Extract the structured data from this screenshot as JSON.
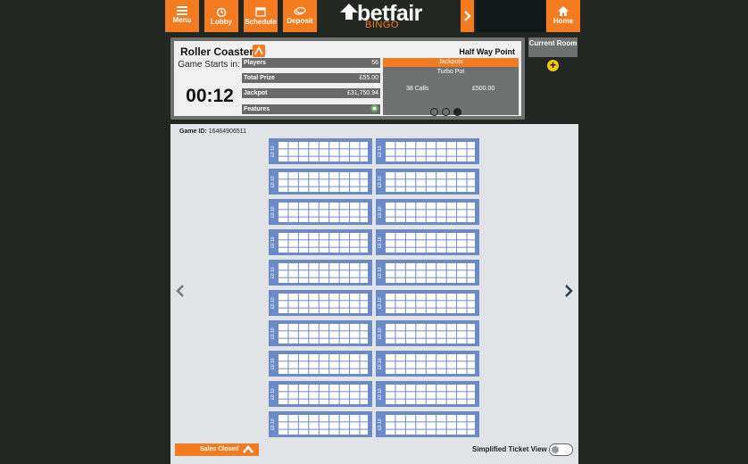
{
  "nav": {
    "menu": "Menu",
    "lobby": "Lobby",
    "schedule": "Schedule",
    "deposit": "Deposit",
    "home": "Home"
  },
  "brand": {
    "name": "betfair",
    "sub": "BINGO"
  },
  "room": {
    "name": "Roller Coaster",
    "starts_label": "Game Starts in:",
    "countdown": "00:12",
    "players_label": "Players",
    "players_value": "56",
    "total_prize_label": "Total Prize",
    "total_prize_value": "£55.00",
    "jackpot_label": "Jackpot",
    "jackpot_value": "£31,750.94",
    "features_label": "Features",
    "halfway": "Half Way Point"
  },
  "jackpots": {
    "header": "Jackpots",
    "name": "Turbo Pot",
    "calls": "38 Calls",
    "amount": "£500.00",
    "active_page": 3,
    "pages": 3
  },
  "current_room": {
    "label": "Current Room"
  },
  "game": {
    "id_label": "Game ID:",
    "id": "16464906511"
  },
  "ticket_price": "£0.10",
  "ticket_count": 20,
  "footer": {
    "sales_closed": "Sales Closed",
    "simplified_view": "Simplified Ticket View",
    "simplified_on": false
  },
  "colors": {
    "accent": "#f47b20",
    "ticket": "#6b8ac7",
    "background": "#232722"
  }
}
